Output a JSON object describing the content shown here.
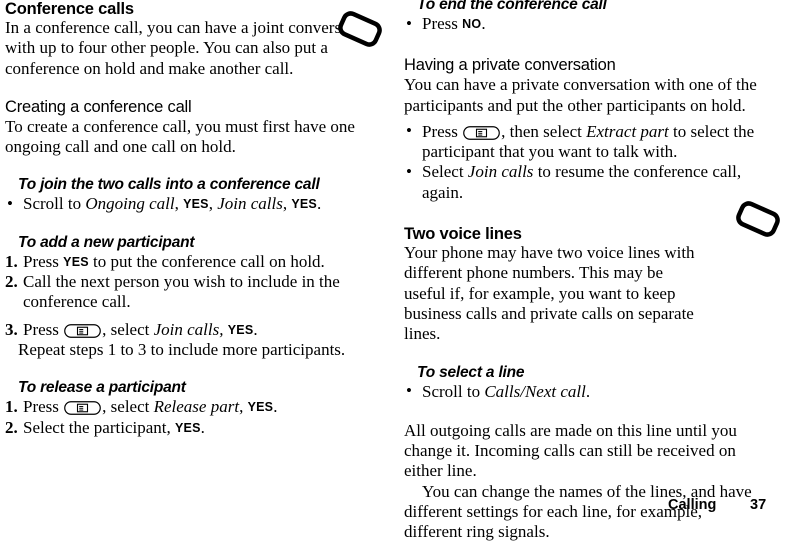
{
  "page": {
    "footer_section": "Calling",
    "footer_page_number": "37",
    "ink_color": "#000000",
    "paper_color": "#ffffff"
  },
  "icons": {
    "phone": "phone-icon",
    "menu_key": "menu-key-icon",
    "bullet": "•"
  },
  "left_column": {
    "heading": "Conference calls",
    "intro": "In a conference call, you can have a joint conversation with up to four other people. You can also put a conference on hold and make another call.",
    "creating": {
      "heading": "Creating a conference call",
      "body": "To create a conference call, you must first have one ongoing call and one call on hold."
    },
    "join": {
      "heading": "To join the two calls into a conference call",
      "bullet_marker": "•",
      "item_pre": "Scroll to ",
      "item_menu1": "Ongoing call",
      "item_sep1": ", ",
      "item_key1": "YES",
      "item_sep2": ", ",
      "item_menu2": "Join calls",
      "item_sep3": ", ",
      "item_key2": "YES",
      "item_end": "."
    },
    "add": {
      "heading": "To add a new participant",
      "steps": [
        {
          "marker": "1.",
          "pre": "Press ",
          "key": "YES",
          "post": " to put the conference call on hold."
        },
        {
          "marker": "2.",
          "pre": "Call the next person you wish to include in the conference call.",
          "key": "",
          "post": ""
        },
        {
          "marker": "3.",
          "pre": "Press ",
          "key": "",
          "post": ""
        }
      ],
      "step3_after_icon": ", select ",
      "step3_menu": "Join calls,",
      "step3_key": "YES",
      "step3_end": ".",
      "repeat_note": "Repeat steps 1 to 3 to include more participants."
    },
    "release": {
      "heading": "To release a participant",
      "step1_marker": "1.",
      "step1_pre": "Press ",
      "step1_after_icon": ", select ",
      "step1_menu": "Release part",
      "step1_sep": ", ",
      "step1_key": "YES",
      "step1_end": ".",
      "step2_marker": "2.",
      "step2_pre": "Select the participant, ",
      "step2_key": "YES",
      "step2_end": "."
    }
  },
  "right_column": {
    "end_call": {
      "heading": "To end the conference call",
      "bullet_marker": "•",
      "item_pre": "Press ",
      "item_key": "NO",
      "item_end": "."
    },
    "private": {
      "heading": "Having a private conversation",
      "body": "You can have a private conversation with one of the participants and put the other participants on hold.",
      "bullets": [
        {
          "marker": "•",
          "pre": "Press ",
          "after_icon": ", then select ",
          "menu": "Extract part",
          "post": " to select the participant that you want to talk with.",
          "has_icon": true
        },
        {
          "marker": "•",
          "pre": "Select ",
          "after_icon": "",
          "menu": "Join calls",
          "post": " to resume the conference call, again.",
          "has_icon": false
        }
      ]
    },
    "two_lines": {
      "heading": "Two voice lines",
      "body": "Your phone may have two voice lines with different phone numbers. This may be useful if, for example, you want to keep business calls and private calls on separate lines."
    },
    "select_line": {
      "heading": "To select a line",
      "bullet_marker": "•",
      "item_pre": "Scroll to ",
      "item_menu": "Calls/Next call",
      "item_end": "."
    },
    "notes": {
      "para1": "All outgoing calls are made on this line until you change it. Incoming calls can still be received on either line.",
      "para2": "You can change the names of the lines, and have different settings for each line, for example, different ring signals."
    }
  }
}
